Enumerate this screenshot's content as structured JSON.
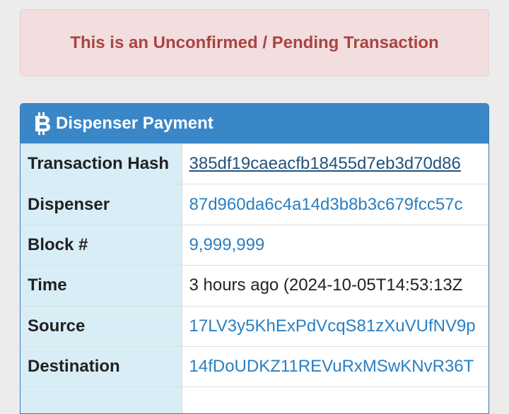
{
  "alert": {
    "text": "This is an Unconfirmed / Pending Transaction"
  },
  "panel": {
    "title": "Dispenser Payment",
    "icon": "bitcoin-icon",
    "colors": {
      "heading_bg": "#3a87c8",
      "label_bg": "#d9edf7",
      "link": "#2a7fc1",
      "alert_bg": "#f2dede",
      "alert_text": "#a94442"
    }
  },
  "rows": [
    {
      "label": "Transaction Hash",
      "value": "385df19caeacfb18455d7eb3d70d86"
    },
    {
      "label": "Dispenser",
      "value": "87d960da6c4a14d3b8b3c679fcc57c"
    },
    {
      "label": "Block #",
      "value": "9,999,999"
    },
    {
      "label": "Time",
      "value": "3 hours ago (2024-10-05T14:53:13Z"
    },
    {
      "label": "Source",
      "value": "17LV3y5KhExPdVcqS81zXuVUfNV9p"
    },
    {
      "label": "Destination",
      "value": "14fDoUDKZ11REVuRxMSwKNvR36T"
    },
    {
      "label": "",
      "value": ""
    }
  ]
}
